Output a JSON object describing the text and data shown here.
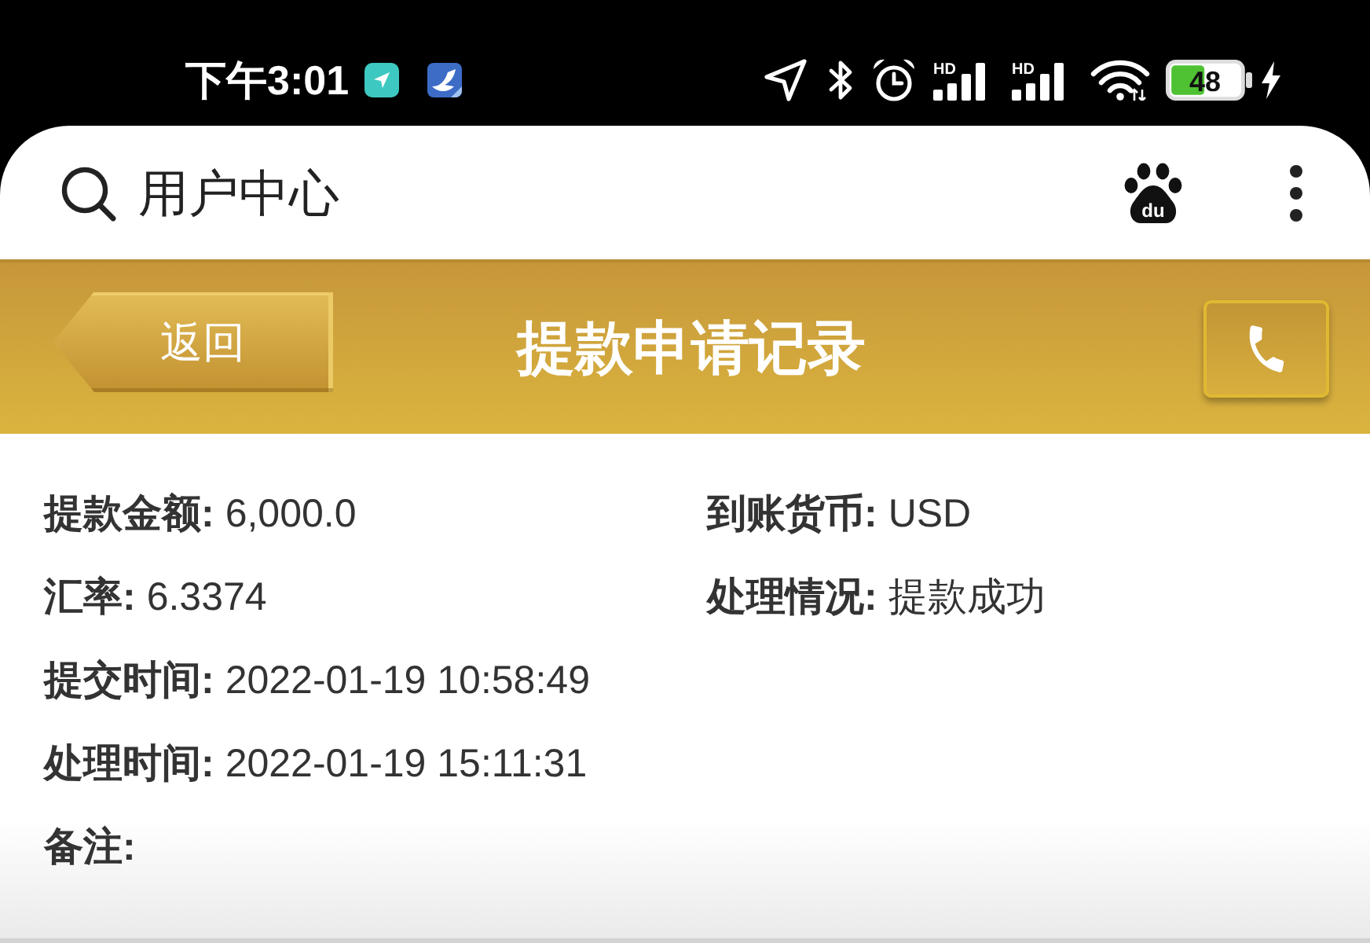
{
  "status_bar": {
    "time": "下午3:01",
    "signals": [
      {
        "label": "HD"
      },
      {
        "label": "HD"
      }
    ],
    "battery": "48"
  },
  "browser_bar": {
    "title": "用户中心",
    "logo_text": "du"
  },
  "header": {
    "back_button": "返回",
    "title": "提款申请记录"
  },
  "details": [
    [
      {
        "label": "提款金额:",
        "value": "6,000.0"
      },
      {
        "label": "到账货币:",
        "value": "USD"
      }
    ],
    [
      {
        "label": "汇率:",
        "value": "6.3374"
      },
      {
        "label": "处理情况:",
        "value": "提款成功"
      }
    ],
    [
      {
        "label": "提交时间:",
        "value": "2022-01-19 10:58:49"
      }
    ],
    [
      {
        "label": "处理时间:",
        "value": "2022-01-19 15:11:31"
      }
    ],
    [
      {
        "label": "备注:"
      }
    ]
  ]
}
